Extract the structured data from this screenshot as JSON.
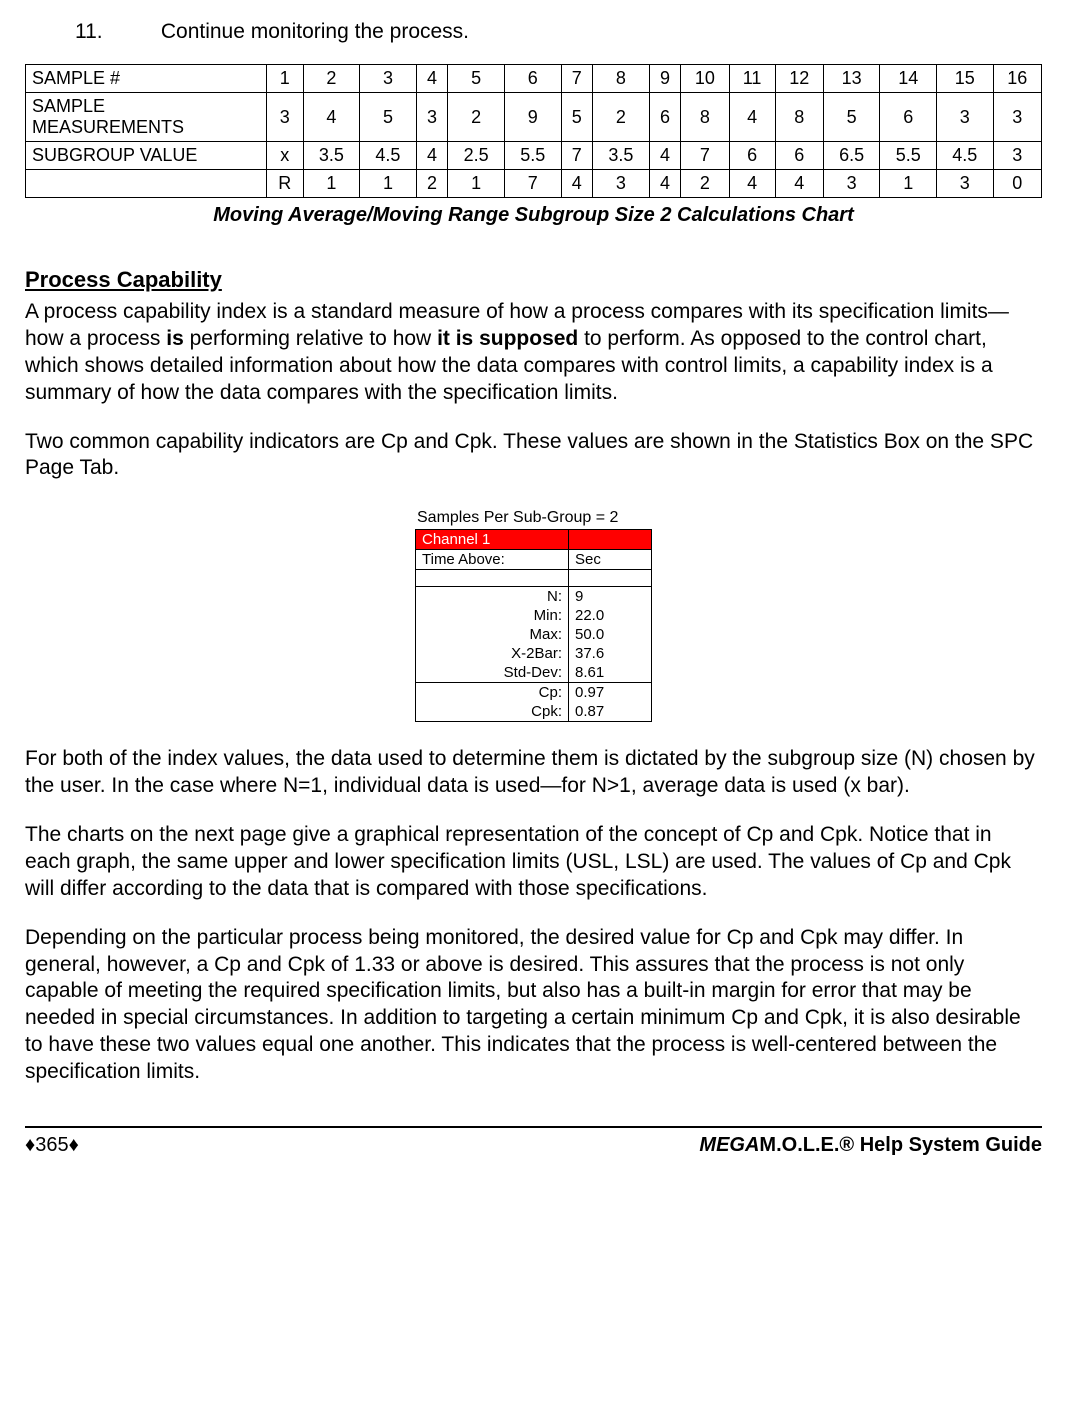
{
  "step": {
    "num": "11.",
    "text": "Continue monitoring the process."
  },
  "table": {
    "rows": [
      {
        "label": "SAMPLE #",
        "cells": [
          "1",
          "2",
          "3",
          "4",
          "5",
          "6",
          "7",
          "8",
          "9",
          "10",
          "11",
          "12",
          "13",
          "14",
          "15",
          "16"
        ]
      },
      {
        "label": "SAMPLE MEASUREMENTS",
        "cells": [
          "3",
          "4",
          "5",
          "3",
          "2",
          "9",
          "5",
          "2",
          "6",
          "8",
          "4",
          "8",
          "5",
          "6",
          "3",
          "3"
        ]
      },
      {
        "label": "SUBGROUP VALUE",
        "cells": [
          "x",
          "3.5",
          "4.5",
          "4",
          "2.5",
          "5.5",
          "7",
          "3.5",
          "4",
          "7",
          "6",
          "6",
          "6.5",
          "5.5",
          "4.5",
          "3"
        ]
      },
      {
        "label": "",
        "cells": [
          "R",
          "1",
          "1",
          "2",
          "1",
          "7",
          "4",
          "3",
          "4",
          "2",
          "4",
          "4",
          "3",
          "1",
          "3",
          "0"
        ]
      }
    ]
  },
  "table_caption": "Moving Average/Moving Range Subgroup Size 2 Calculations Chart",
  "section_heading": "Process Capability",
  "para1_a": "A process capability index is a standard measure of how a process compares with its specification limits—how a process ",
  "para1_b": "is",
  "para1_c": " performing relative to how ",
  "para1_d": "it is supposed",
  "para1_e": " to perform. As opposed to the control chart, which shows detailed information about how the data compares with control limits, a capability index is a summary of how the data compares with the specification limits.",
  "para2": "Two common capability indicators are Cp and Cpk.  These values are shown in the Statistics Box on the SPC Page Tab.",
  "statsbox": {
    "caption": "Samples Per Sub-Group = 2",
    "channel": "Channel 1",
    "timeabove_l": "Time Above:",
    "timeabove_r": "Sec",
    "rows": [
      {
        "l": "N:",
        "r": "9"
      },
      {
        "l": "Min:",
        "r": "22.0"
      },
      {
        "l": "Max:",
        "r": "50.0"
      },
      {
        "l": "X-2Bar:",
        "r": "37.6"
      },
      {
        "l": "Std-Dev:",
        "r": "8.61"
      }
    ],
    "rows2": [
      {
        "l": "Cp:",
        "r": "0.97"
      },
      {
        "l": "Cpk:",
        "r": "0.87"
      }
    ]
  },
  "para3": "For both of the index values, the data used to determine them is dictated by the subgroup size (N) chosen by the user. In the case where N=1, individual data is used—for N>1, average data is used (x bar).",
  "para4": "The charts on the next page give a graphical representation of the concept of Cp and Cpk. Notice that in each graph, the same upper and lower specification limits (USL, LSL) are used.  The values of Cp and Cpk will differ according to the data that is compared with those specifications.",
  "para5": "Depending on the particular process being monitored, the desired value for Cp and Cpk may differ. In general, however, a Cp and Cpk of 1.33 or above is desired. This assures that the process is not only capable of meeting the required specification limits, but also has a built-in margin for error that may be needed in special circumstances. In addition to targeting a certain minimum Cp and Cpk, it is also desirable to have these two values equal one another. This indicates that the process is well-centered between the specification limits.",
  "footer": {
    "page": "365",
    "guide_mega": "MEGA",
    "guide_rest": "M.O.L.E.® Help System Guide"
  }
}
